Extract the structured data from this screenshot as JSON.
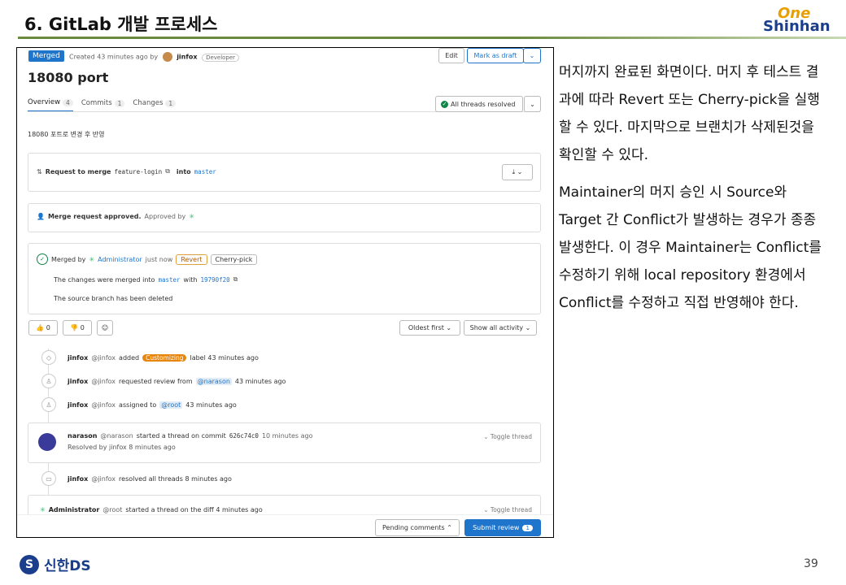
{
  "slide": {
    "title": "6. GitLab 개발 프로세스",
    "logo_one": "One",
    "logo_shinhan": "Shinhan",
    "footer_brand": "신한DS",
    "page_number": "39"
  },
  "commentary": {
    "paragraph1": "머지까지 완료된 화면이다. 머지 후 테스트 결과에 따라 Revert 또는 Cherry-pick을 실행할 수 있다. 마지막으로 브랜치가 삭제된것을 확인할 수 있다.",
    "paragraph2": "Maintainer의 머지 승인 시 Source와 Target 간 Conflict가 발생하는 경우가 종종 발생한다. 이 경우 Maintainer는 Conflict를 수정하기 위해 local repository 환경에서 Conflict를 수정하고 직접 반영해야 한다."
  },
  "mr": {
    "status_badge": "Merged",
    "created_text": "Created 43 minutes ago by",
    "author": "jinfox",
    "author_role": "Developer",
    "edit_label": "Edit",
    "mark_draft_label": "Mark as draft",
    "title": "18080 port",
    "tabs": [
      {
        "label": "Overview",
        "count": "4"
      },
      {
        "label": "Commits",
        "count": "1"
      },
      {
        "label": "Changes",
        "count": "1"
      }
    ],
    "threads_resolved": "All threads resolved",
    "description": "18080 포트로 변경 후 반영",
    "request_to_merge": "Request to merge",
    "source_branch": "feature-login",
    "into_label": "into",
    "target_branch": "master",
    "approved_text": "Merge request approved.",
    "approved_by": "Approved by",
    "merged_by_label": "Merged by",
    "merged_by_user": "Administrator",
    "merged_time": "just now",
    "revert_label": "Revert",
    "cherry_pick_label": "Cherry-pick",
    "merged_into_text": "The changes were merged into",
    "merged_into_branch": "master",
    "with_label": "with",
    "commit_sha": "19790f20",
    "branch_deleted": "The source branch has been deleted",
    "thumbs_up_count": "0",
    "thumbs_down_count": "0",
    "sort_label": "Oldest first",
    "filter_label": "Show all activity"
  },
  "activity": [
    {
      "user": "jinfox",
      "handle": "@jinfox",
      "pre": "added",
      "label": "Customizing",
      "post": "label 43 minutes ago"
    },
    {
      "user": "jinfox",
      "handle": "@jinfox",
      "pre": "requested review from",
      "mention": "@narason",
      "post": "43 minutes ago"
    },
    {
      "user": "jinfox",
      "handle": "@jinfox",
      "pre": "assigned to",
      "mention": "@root",
      "post": "43 minutes ago"
    }
  ],
  "thread1": {
    "user": "narason",
    "handle": "@narason",
    "text": "started a thread on commit",
    "commit": "626c74c0",
    "time": "10 minutes ago",
    "resolved": "Resolved by jinfox 8 minutes ago",
    "toggle": "Toggle thread"
  },
  "resolved_all": {
    "user": "jinfox",
    "handle": "@jinfox",
    "text": "resolved all threads 8 minutes ago"
  },
  "thread2": {
    "user": "Administrator",
    "handle": "@root",
    "text": "started a thread on the diff 4 minutes ago",
    "toggle": "Toggle thread"
  },
  "review": {
    "pending_label": "Pending comments",
    "submit_label": "Submit review",
    "submit_count": "1"
  }
}
